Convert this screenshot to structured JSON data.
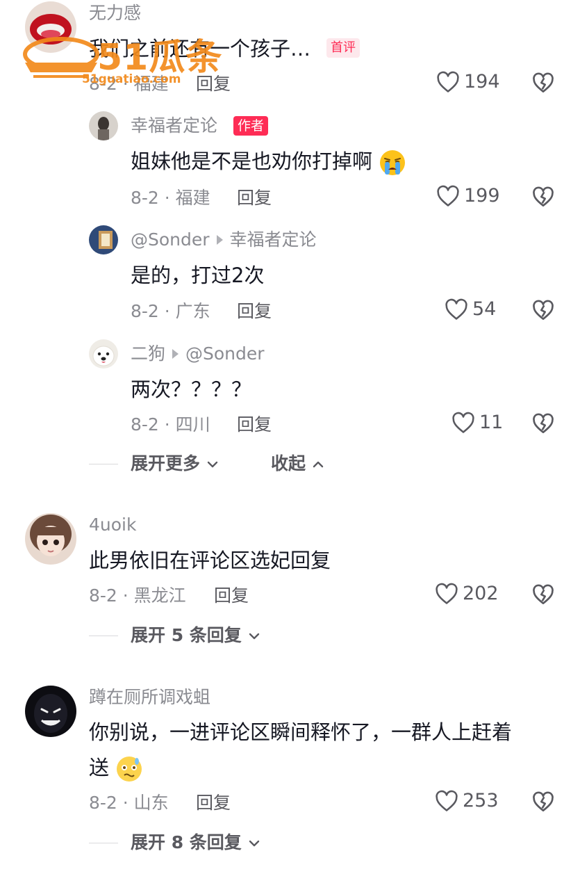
{
  "comments": [
    {
      "user": "无力感",
      "text": "我们之前还有一个孩子…",
      "first_badge": "首评",
      "date_loc": "8-2 · 福建",
      "reply": "回复",
      "likes": "194"
    },
    {
      "user": "4uoik",
      "text": "此男依旧在评论区选妃回复",
      "date_loc": "8-2 · 黑龙江",
      "reply": "回复",
      "likes": "202",
      "expand": "展开 5 条回复"
    },
    {
      "user": "蹲在厕所调戏蛆",
      "text_line1": "你别说，一进评论区瞬间释怀了，一群人上赶着",
      "text_line2": "送",
      "date_loc": "8-2 · 山东",
      "reply": "回复",
      "likes": "253",
      "expand": "展开 8 条回复"
    }
  ],
  "replies": [
    {
      "user": "幸福者定论",
      "author_badge": "作者",
      "text": "姐妹他是不是也劝你打掉啊",
      "date_loc": "8-2 · 福建",
      "reply": "回复",
      "likes": "199"
    },
    {
      "user": "@Sonder",
      "reply_to": "幸福者定论",
      "text": "是的，打过2次",
      "date_loc": "8-2 · 广东",
      "reply": "回复",
      "likes": "54"
    },
    {
      "user": "二狗",
      "reply_to": "@Sonder",
      "text": "两次？？？？",
      "date_loc": "8-2 · 四川",
      "reply": "回复",
      "likes": "11"
    }
  ],
  "thread_controls": {
    "expand_more": "展开更多",
    "collapse": "收起"
  },
  "watermark": {
    "brand": "51瓜条",
    "url": "51guatiao.com"
  },
  "colors": {
    "author_badge": "#fe2c55",
    "watermark": "#f28a1c"
  }
}
